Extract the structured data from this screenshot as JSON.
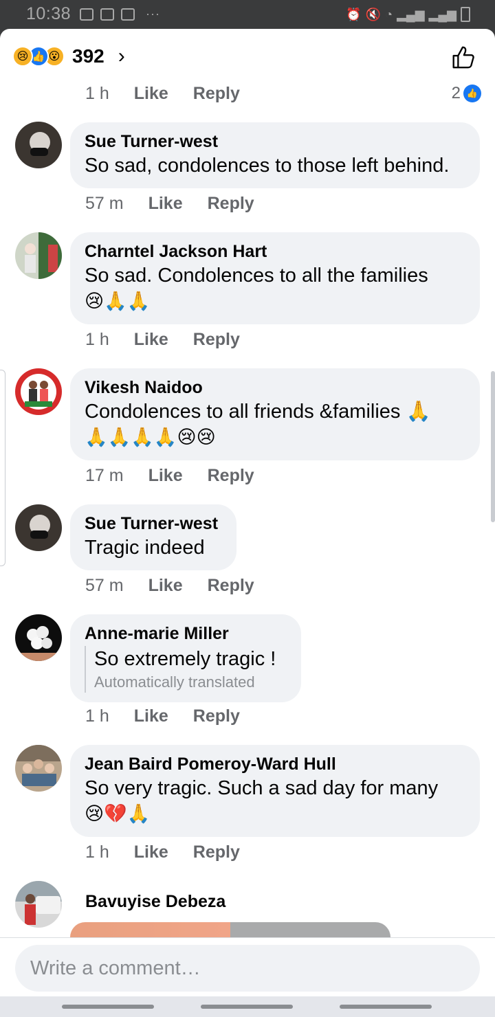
{
  "status_bar": {
    "time": "10:38",
    "extra": "···"
  },
  "header": {
    "reaction_icons": [
      "sad-icon",
      "like-icon",
      "wow-icon"
    ],
    "reaction_count": "392",
    "chevron": "›"
  },
  "first_meta": {
    "time": "1 h",
    "like": "Like",
    "reply": "Reply",
    "reaction_count": "2"
  },
  "comments": [
    {
      "author": "Sue Turner-west",
      "lines": [
        "So sad, condolences to those left behind."
      ],
      "time": "57 m",
      "like": "Like",
      "reply": "Reply"
    },
    {
      "author": "Charntel Jackson Hart",
      "lines": [
        "So sad. Condolences to all the families",
        "😢🙏🙏"
      ],
      "time": "1 h",
      "like": "Like",
      "reply": "Reply"
    },
    {
      "author": "Vikesh Naidoo",
      "lines": [
        "Condolences to all friends &families 🙏",
        "🙏🙏🙏🙏😢😢"
      ],
      "time": "17 m",
      "like": "Like",
      "reply": "Reply"
    },
    {
      "author": "Sue Turner-west",
      "lines": [
        "Tragic indeed"
      ],
      "time": "57 m",
      "like": "Like",
      "reply": "Reply"
    },
    {
      "author": "Anne-marie Miller",
      "lines": [
        "So extremely tragic !"
      ],
      "translated_note": "Automatically translated",
      "time": "1 h",
      "like": "Like",
      "reply": "Reply"
    },
    {
      "author": "Jean Baird Pomeroy-Ward Hull",
      "lines": [
        "So very tragic. Such a sad day for many",
        "😢💔🙏"
      ],
      "time": "1 h",
      "like": "Like",
      "reply": "Reply"
    },
    {
      "author": "Bavuyise Debeza"
    }
  ],
  "composer": {
    "placeholder": "Write a comment…"
  },
  "colors": {
    "accent": "#1877f2",
    "bubble": "#f0f2f5",
    "meta": "#65676b"
  }
}
